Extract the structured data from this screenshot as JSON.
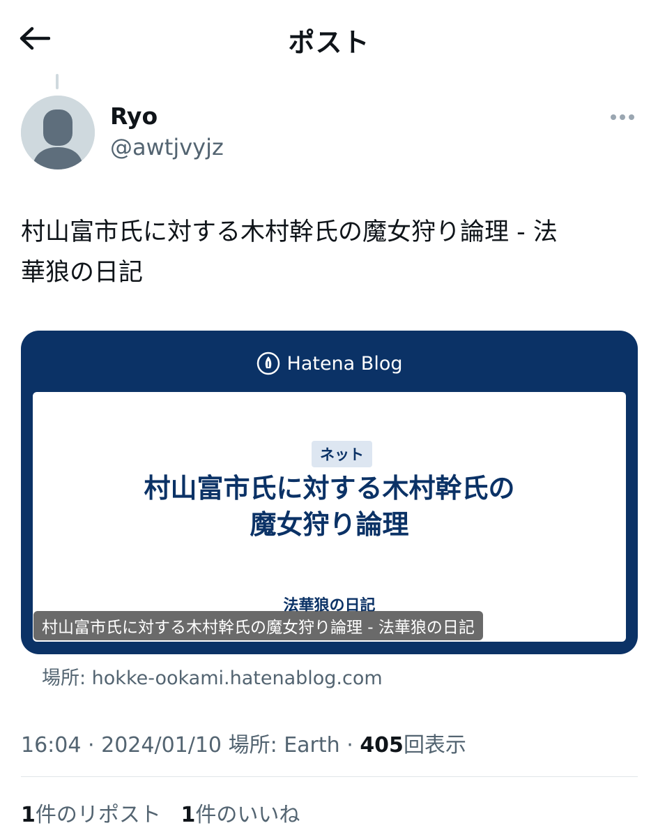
{
  "header": {
    "title": "ポスト",
    "back_icon": "arrow-left-icon"
  },
  "author": {
    "display_name": "Ryo",
    "handle": "@awtjvyjz",
    "avatar_icon": "default-avatar-icon"
  },
  "tweet": {
    "text_line1": "村山富市氏に対する木村幹氏の魔女狩り論理 - 法",
    "text_line2": "華狼の日記"
  },
  "card": {
    "brand": "Hatena Blog",
    "tag": "ネット",
    "headline_line1": "村山富市氏に対する木村幹氏の",
    "headline_line2": "魔女狩り論理",
    "blog_name": "法華狼の日記",
    "caption": "村山富市氏に対する木村幹氏の魔女狩り論理 - 法華狼の日記",
    "source": "場所: hokke-ookami.hatenablog.com",
    "bg_color": "#0b3266"
  },
  "meta": {
    "time": "16:04",
    "sep": "·",
    "date": "2024/01/10",
    "location": "場所: Earth",
    "views_count": "405",
    "views_label": "回表示"
  },
  "stats": {
    "reposts_count": "1",
    "reposts_label": "件のリポスト",
    "likes_count": "1",
    "likes_label": "件のいいね"
  }
}
